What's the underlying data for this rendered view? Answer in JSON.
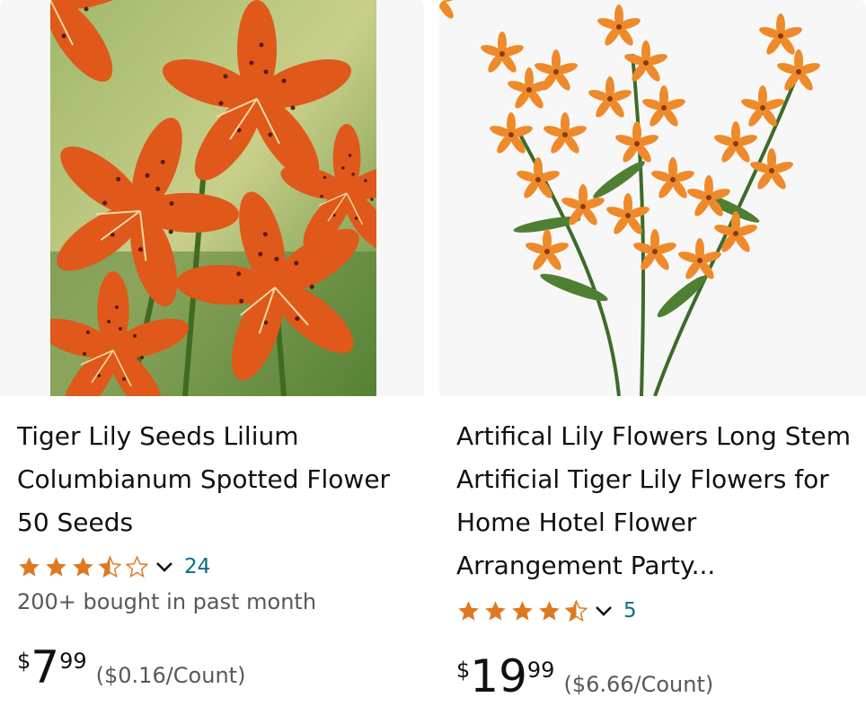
{
  "colors": {
    "star": "#de7921",
    "link": "#007185",
    "secondary_text": "#565959",
    "image_bg": "#f7f7f7"
  },
  "products": [
    {
      "title": "Tiger Lily Seeds Lilium Columbianum Spotted Flower 50 Seeds",
      "rating": 3.5,
      "stars": [
        "full",
        "full",
        "full",
        "half",
        "empty"
      ],
      "review_count": "24",
      "bought": "200+ bought in past month",
      "price": {
        "currency": "$",
        "whole": "7",
        "fraction": "99",
        "unit_price": "($0.16/Count)"
      }
    },
    {
      "title": "Artifical Lily Flowers Long Stem Artificial Tiger Lily Flowers for Home Hotel Flower Arrangement Party...",
      "rating": 4.5,
      "stars": [
        "full",
        "full",
        "full",
        "full",
        "half"
      ],
      "review_count": "5",
      "price": {
        "currency": "$",
        "whole": "19",
        "fraction": "99",
        "unit_price": "($6.66/Count)"
      }
    }
  ]
}
